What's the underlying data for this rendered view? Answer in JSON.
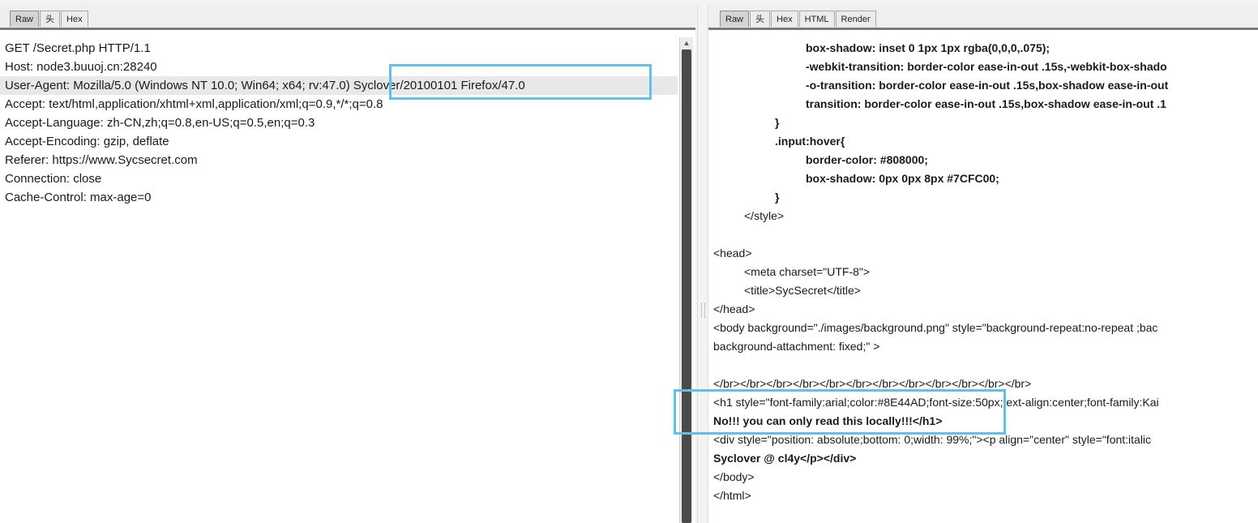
{
  "request": {
    "tabs": [
      "Raw",
      "头",
      "Hex"
    ],
    "active_tab": "Raw",
    "lines": [
      "GET /Secret.php HTTP/1.1",
      "Host: node3.buuoj.cn:28240",
      "User-Agent: Mozilla/5.0 (Windows NT 10.0; Win64; x64; rv:47.0) Syclover/20100101 Firefox/47.0",
      "Accept: text/html,application/xhtml+xml,application/xml;q=0.9,*/*;q=0.8",
      "Accept-Language: zh-CN,zh;q=0.8,en-US;q=0.5,en;q=0.3",
      "Accept-Encoding: gzip, deflate",
      "Referer: https://www.Sycsecret.com",
      "Connection: close",
      "Cache-Control: max-age=0"
    ],
    "highlighted_line": 2
  },
  "response": {
    "tabs": [
      "Raw",
      "头",
      "Hex",
      "HTML",
      "Render"
    ],
    "active_tab": "Raw",
    "lines": [
      "box-shadow: inset 0 1px 1px rgba(0,0,0,.075);",
      "-webkit-transition: border-color ease-in-out .15s,-webkit-box-shado",
      "-o-transition: border-color ease-in-out .15s,box-shadow ease-in-out",
      "transition: border-color ease-in-out .15s,box-shadow ease-in-out .1",
      "}",
      ".input:hover{",
      "border-color: #808000;",
      "box-shadow: 0px 0px 8px #7CFC00;",
      "}",
      "</style>",
      "",
      "<head>",
      "<meta charset=\"UTF-8\">",
      "<title>SycSecret</title>",
      "</head>",
      "<body background=\"./images/background.png\" style=\"background-repeat:no-repeat ;bac",
      "background-attachment: fixed;\" >",
      "",
      "</br></br></br></br></br></br></br></br></br></br></br></br>",
      "<h1 style=\"font-family:arial;color:#8E44AD;font-size:50px;text-align:center;font-family:Kai",
      "No!!! you can only read this locally!!!</h1>",
      "<div style=\"position: absolute;bottom: 0;width: 99%;\"><p align=\"center\" style=\"font:italic",
      "Syclover @ cl4y</p></div>",
      "</body>",
      "</html>"
    ]
  },
  "colors": {
    "annotation_box": "#5ec2e8",
    "highlight_row": "#e8e8e8"
  }
}
